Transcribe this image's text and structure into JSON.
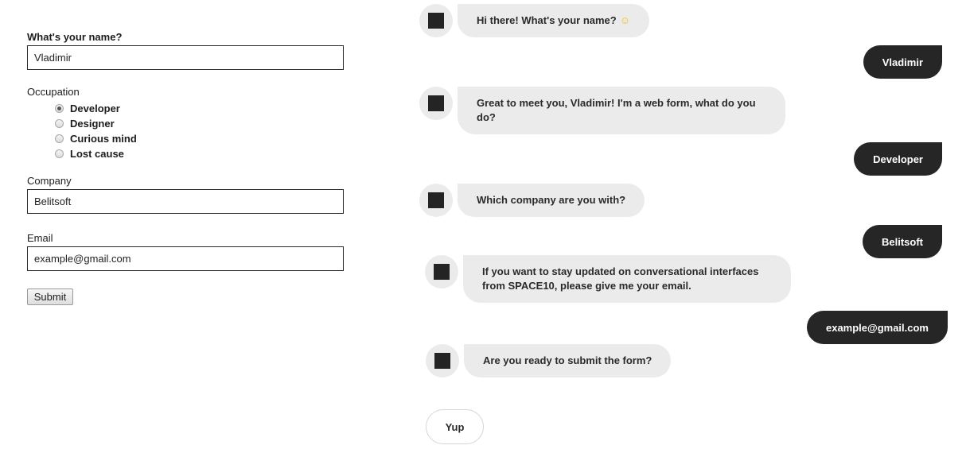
{
  "form": {
    "name_label": "What's your name?",
    "name_value": "Vladimir",
    "occupation_label": "Occupation",
    "occupation_options": [
      {
        "label": "Developer",
        "checked": true
      },
      {
        "label": "Designer",
        "checked": false
      },
      {
        "label": "Curious mind",
        "checked": false
      },
      {
        "label": "Lost cause",
        "checked": false
      }
    ],
    "company_label": "Company",
    "company_value": "Belitsoft",
    "email_label": "Email",
    "email_value": "example@gmail.com",
    "submit_label": "Submit"
  },
  "chat": {
    "messages": [
      {
        "from": "bot",
        "text": "Hi there! What's your name?",
        "emoji": "smiley-face"
      },
      {
        "from": "user",
        "text": "Vladimir"
      },
      {
        "from": "bot",
        "text": "Great to meet you, Vladimir! I'm a web form, what do you do?"
      },
      {
        "from": "user",
        "text": "Developer"
      },
      {
        "from": "bot",
        "text": "Which company are you with?"
      },
      {
        "from": "user",
        "text": "Belitsoft"
      },
      {
        "from": "bot",
        "text": "If you want to stay updated on conversational interfaces from SPACE10, please give me your email."
      },
      {
        "from": "user",
        "text": "example@gmail.com"
      },
      {
        "from": "bot",
        "text": "Are you ready to submit the form?"
      }
    ],
    "emoji_glyph": "☺",
    "reply_option": "Yup"
  },
  "colors": {
    "bot_bubble": "#ebebeb",
    "user_bubble": "#262626",
    "emoji": "#f2c01e"
  }
}
